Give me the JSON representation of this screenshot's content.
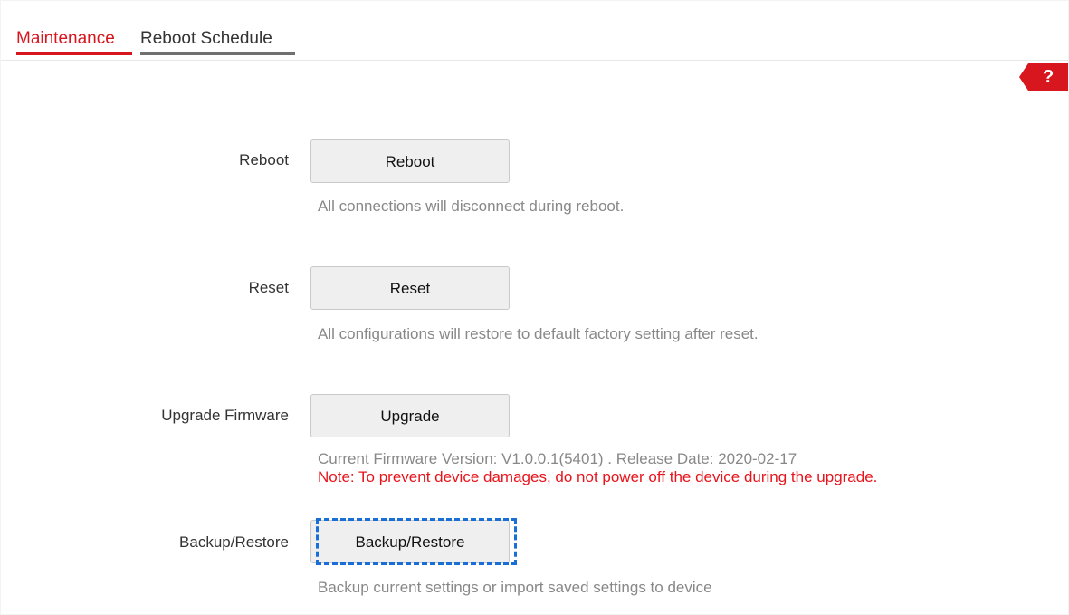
{
  "tabs": [
    {
      "label": "Maintenance",
      "active": true
    },
    {
      "label": "Reboot Schedule",
      "active": false
    }
  ],
  "help": {
    "label": "?"
  },
  "rows": {
    "reboot": {
      "label": "Reboot",
      "button": "Reboot",
      "hint": "All connections will disconnect during reboot."
    },
    "reset": {
      "label": "Reset",
      "button": "Reset",
      "hint": "All configurations will restore to default factory setting after reset."
    },
    "upgrade": {
      "label": "Upgrade Firmware",
      "button": "Upgrade",
      "hint": "Current Firmware Version: V1.0.0.1(5401) . Release Date: 2020-02-17",
      "note": "Note: To prevent device damages, do not power off the device during the upgrade."
    },
    "backup": {
      "label": "Backup/Restore",
      "button": "Backup/Restore",
      "hint": "Backup current settings or import saved settings to device"
    }
  },
  "colors": {
    "accent": "#d7161e",
    "note": "#e8141c",
    "focus": "#1a6fd6",
    "hint": "#888888"
  }
}
